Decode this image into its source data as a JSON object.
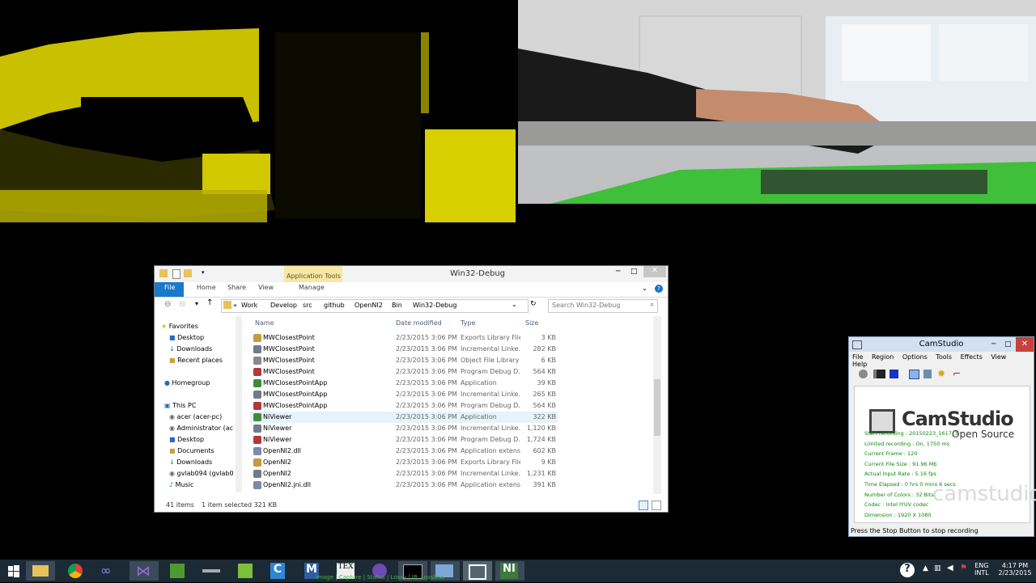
{
  "explorer": {
    "title": "Win32-Debug",
    "context_tab": "Application Tools",
    "tabs": [
      "File",
      "Home",
      "Share",
      "View",
      "Manage"
    ],
    "breadcrumb": [
      "«",
      "Work",
      "Develop",
      "src",
      "github",
      "OpenNI2",
      "Bin",
      "Win32-Debug"
    ],
    "search_placeholder": "Search Win32-Debug",
    "columns": [
      "Name",
      "Date modified",
      "Type",
      "Size"
    ],
    "nav": [
      "Favorites",
      "Desktop",
      "Downloads",
      "Recent places",
      "Homegroup",
      "This PC",
      "acer (acer-pc)",
      "Administrator (ac",
      "Desktop",
      "Documents",
      "Downloads",
      "gvlab094 (gvlab0",
      "Music"
    ],
    "files": [
      {
        "name": "MWClosestPoint",
        "date": "2/23/2015 3:06 PM",
        "type": "Exports Library File",
        "size": "3 KB"
      },
      {
        "name": "MWClosestPoint",
        "date": "2/23/2015 3:06 PM",
        "type": "Incremental Linke...",
        "size": "282 KB"
      },
      {
        "name": "MWClosestPoint",
        "date": "2/23/2015 3:06 PM",
        "type": "Object File Library",
        "size": "6 KB"
      },
      {
        "name": "MWClosestPoint",
        "date": "2/23/2015 3:06 PM",
        "type": "Program Debug D...",
        "size": "564 KB"
      },
      {
        "name": "MWClosestPointApp",
        "date": "2/23/2015 3:06 PM",
        "type": "Application",
        "size": "39 KB"
      },
      {
        "name": "MWClosestPointApp",
        "date": "2/23/2015 3:06 PM",
        "type": "Incremental Linke...",
        "size": "265 KB"
      },
      {
        "name": "MWClosestPointApp",
        "date": "2/23/2015 3:06 PM",
        "type": "Program Debug D...",
        "size": "564 KB"
      },
      {
        "name": "NiViewer",
        "date": "2/23/2015 3:06 PM",
        "type": "Application",
        "size": "322 KB"
      },
      {
        "name": "NiViewer",
        "date": "2/23/2015 3:06 PM",
        "type": "Incremental Linke...",
        "size": "1,120 KB"
      },
      {
        "name": "NiViewer",
        "date": "2/23/2015 3:06 PM",
        "type": "Program Debug D...",
        "size": "1,724 KB"
      },
      {
        "name": "OpenNI2.dll",
        "date": "2/23/2015 3:06 PM",
        "type": "Application extens...",
        "size": "602 KB"
      },
      {
        "name": "OpenNI2",
        "date": "2/23/2015 3:06 PM",
        "type": "Exports Library File",
        "size": "9 KB"
      },
      {
        "name": "OpenNI2",
        "date": "2/23/2015 3:06 PM",
        "type": "Incremental Linke...",
        "size": "1,231 KB"
      },
      {
        "name": "OpenNI2.jni.dll",
        "date": "2/23/2015 3:06 PM",
        "type": "Application extens...",
        "size": "391 KB"
      }
    ],
    "status_items": "41 items",
    "status_selected": "1 item selected  321 KB"
  },
  "camstudio": {
    "title": "CamStudio",
    "menu": [
      "File",
      "Region",
      "Options",
      "Tools",
      "Effects",
      "View",
      "Help"
    ],
    "logo": "CamStudio",
    "logo_sub": "Open Source",
    "watermark": "camstudio.org",
    "info": [
      "Start recording : 20150223_1617_3",
      "Limited recording : On, 1750 ms",
      "Current Frame : 120",
      "Current File Size : 91.96 Mb",
      "Actual Input Rate : 5.16 fps",
      "Time Elapsed : 0 hrs 0 mins 6 secs",
      "Number of Colors : 32 Bits",
      "Codec : Intel IYUV codec",
      "Dimension : 1920 X 1080"
    ],
    "status": "Press the Stop Button to stop recording"
  },
  "taskbar": {
    "lang": "ENG",
    "layout": "INTL",
    "time": "4:17 PM",
    "date": "2/23/2015",
    "overlay_text": "Image | Capture | Status | Lossy | IR: Lossless"
  }
}
